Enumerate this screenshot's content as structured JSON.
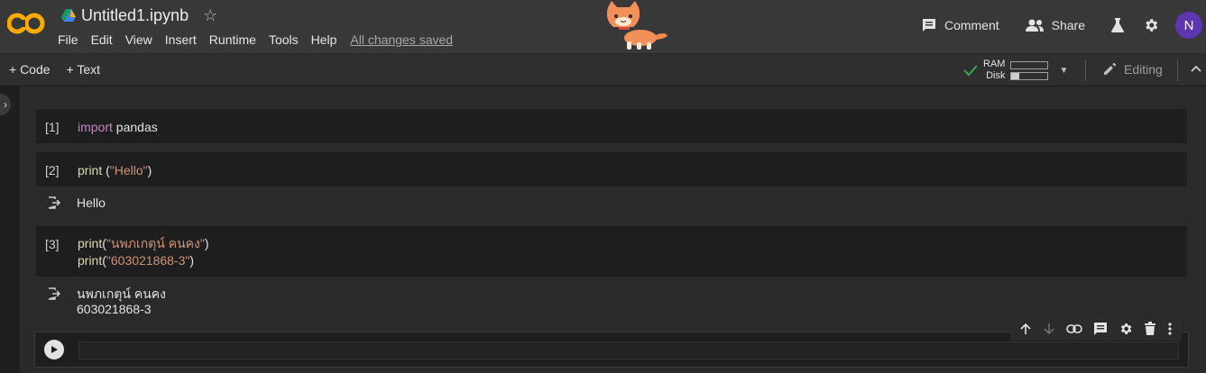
{
  "header": {
    "logo_text": "CO",
    "title": "Untitled1.ipynb",
    "menu": [
      "File",
      "Edit",
      "View",
      "Insert",
      "Runtime",
      "Tools",
      "Help"
    ],
    "save_status": "All changes saved",
    "comment_label": "Comment",
    "share_label": "Share",
    "avatar_initial": "N"
  },
  "toolbar": {
    "code_label": "+ Code",
    "text_label": "+ Text",
    "ram_label": "RAM",
    "disk_label": "Disk",
    "ram_usage": 0.0,
    "disk_usage": 0.22,
    "editing_label": "Editing"
  },
  "cells": [
    {
      "number": "[1]",
      "lines": [
        {
          "parts": [
            {
              "t": "import",
              "c": "kw"
            },
            {
              "t": " pandas",
              "c": ""
            }
          ]
        }
      ],
      "output": null
    },
    {
      "number": "[2]",
      "lines": [
        {
          "parts": [
            {
              "t": "print",
              "c": "fn"
            },
            {
              "t": " (",
              "c": ""
            },
            {
              "t": "\"Hello\"",
              "c": "str"
            },
            {
              "t": ")",
              "c": ""
            }
          ]
        }
      ],
      "output": [
        "Hello"
      ]
    },
    {
      "number": "[3]",
      "lines": [
        {
          "parts": [
            {
              "t": "print",
              "c": "fn"
            },
            {
              "t": "(",
              "c": ""
            },
            {
              "t": "\"นพภเกตุน์ คนคง\"",
              "c": "str"
            },
            {
              "t": ")",
              "c": ""
            }
          ]
        },
        {
          "parts": [
            {
              "t": "print",
              "c": "fn"
            },
            {
              "t": "(",
              "c": ""
            },
            {
              "t": "\"603021868-3\"",
              "c": "str"
            },
            {
              "t": ")",
              "c": ""
            }
          ]
        }
      ],
      "output": [
        "นพภเกตุน์ คนคง",
        "603021868-3"
      ]
    }
  ],
  "colors": {
    "accent_logo": "#f9ab00",
    "avatar_bg": "#5e35b1",
    "connected_check": "#34a853"
  }
}
